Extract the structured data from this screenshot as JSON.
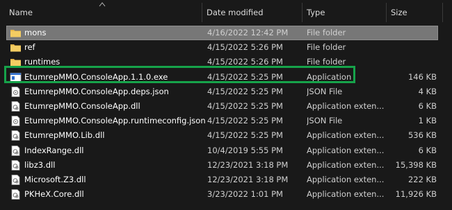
{
  "columns": {
    "name": "Name",
    "date": "Date modified",
    "type": "Type",
    "size": "Size"
  },
  "files": [
    {
      "name": "mons",
      "date": "4/16/2022 12:42 PM",
      "type": "File folder",
      "size": "",
      "icon": "folder-icon",
      "selected": true
    },
    {
      "name": "ref",
      "date": "4/15/2022 5:26 PM",
      "type": "File folder",
      "size": "",
      "icon": "folder-icon"
    },
    {
      "name": "runtimes",
      "date": "4/15/2022 5:26 PM",
      "type": "File folder",
      "size": "",
      "icon": "folder-icon"
    },
    {
      "name": "EtumrepMMO.ConsoleApp.1.1.0.exe",
      "date": "4/15/2022 5:25 PM",
      "type": "Application",
      "size": "146 KB",
      "icon": "application-icon",
      "highlighted": true
    },
    {
      "name": "EtumrepMMO.ConsoleApp.deps.json",
      "date": "4/15/2022 5:25 PM",
      "type": "JSON File",
      "size": "4 KB",
      "icon": "json-file-icon"
    },
    {
      "name": "EtumrepMMO.ConsoleApp.dll",
      "date": "4/15/2022 5:25 PM",
      "type": "Application exten...",
      "size": "6 KB",
      "icon": "dll-file-icon"
    },
    {
      "name": "EtumrepMMO.ConsoleApp.runtimeconfig.json",
      "date": "4/15/2022 5:25 PM",
      "type": "JSON File",
      "size": "1 KB",
      "icon": "json-file-icon"
    },
    {
      "name": "EtumrepMMO.Lib.dll",
      "date": "4/15/2022 5:25 PM",
      "type": "Application exten...",
      "size": "536 KB",
      "icon": "dll-file-icon"
    },
    {
      "name": "IndexRange.dll",
      "date": "10/4/2019 5:55 PM",
      "type": "Application exten...",
      "size": "6 KB",
      "icon": "dll-file-icon"
    },
    {
      "name": "libz3.dll",
      "date": "12/23/2021 3:18 PM",
      "type": "Application exten...",
      "size": "15,398 KB",
      "icon": "dll-file-icon"
    },
    {
      "name": "Microsoft.Z3.dll",
      "date": "12/23/2021 3:18 PM",
      "type": "Application exten...",
      "size": "222 KB",
      "icon": "dll-file-icon"
    },
    {
      "name": "PKHeX.Core.dll",
      "date": "3/23/2022 1:01 PM",
      "type": "Application exten...",
      "size": "11,926 KB",
      "icon": "dll-file-icon"
    }
  ],
  "colors": {
    "background": "#191919",
    "selected_row": "#777777",
    "highlight_box": "#16a34a",
    "folder": "#e8b84a"
  }
}
